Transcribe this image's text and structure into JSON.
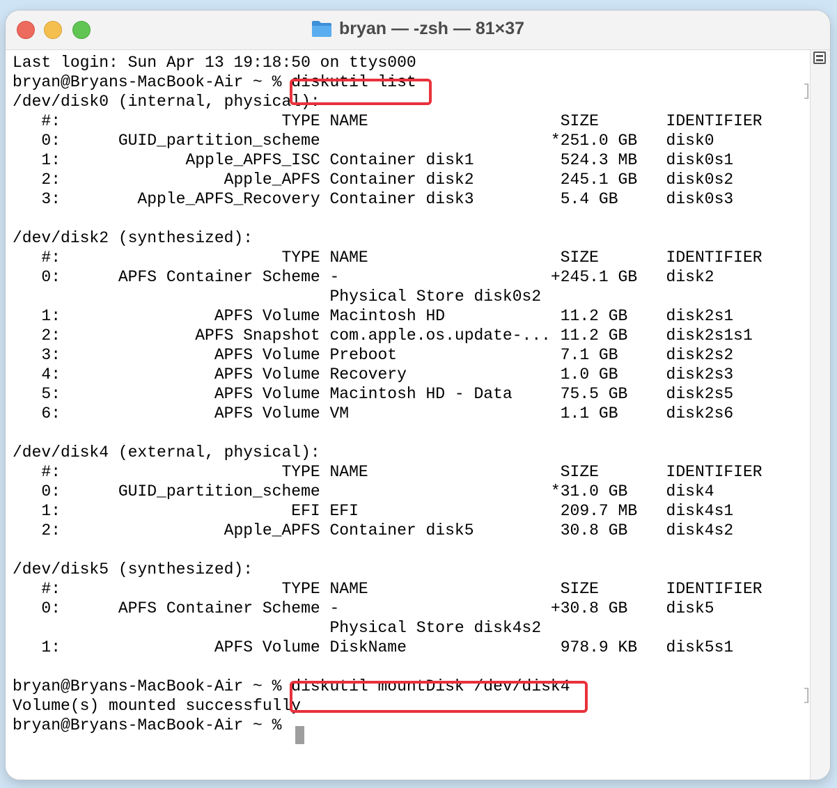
{
  "window": {
    "title": "bryan — -zsh — 81×37"
  },
  "terminal": {
    "lines": [
      "Last login: Sun Apr 13 19:18:50 on ttys000",
      "bryan@Bryans-MacBook-Air ~ % diskutil list",
      "/dev/disk0 (internal, physical):",
      "   #:                       TYPE NAME                    SIZE       IDENTIFIER",
      "   0:      GUID_partition_scheme                        *251.0 GB   disk0",
      "   1:             Apple_APFS_ISC Container disk1         524.3 MB   disk0s1",
      "   2:                 Apple_APFS Container disk2         245.1 GB   disk0s2",
      "   3:        Apple_APFS_Recovery Container disk3         5.4 GB     disk0s3",
      "",
      "/dev/disk2 (synthesized):",
      "   #:                       TYPE NAME                    SIZE       IDENTIFIER",
      "   0:      APFS Container Scheme -                      +245.1 GB   disk2",
      "                                 Physical Store disk0s2",
      "   1:                APFS Volume Macintosh HD            11.2 GB    disk2s1",
      "   2:              APFS Snapshot com.apple.os.update-... 11.2 GB    disk2s1s1",
      "   3:                APFS Volume Preboot                 7.1 GB     disk2s2",
      "   4:                APFS Volume Recovery                1.0 GB     disk2s3",
      "   5:                APFS Volume Macintosh HD - Data     75.5 GB    disk2s5",
      "   6:                APFS Volume VM                      1.1 GB     disk2s6",
      "",
      "/dev/disk4 (external, physical):",
      "   #:                       TYPE NAME                    SIZE       IDENTIFIER",
      "   0:      GUID_partition_scheme                        *31.0 GB    disk4",
      "   1:                        EFI EFI                     209.7 MB   disk4s1",
      "   2:                 Apple_APFS Container disk5         30.8 GB    disk4s2",
      "",
      "/dev/disk5 (synthesized):",
      "   #:                       TYPE NAME                    SIZE       IDENTIFIER",
      "   0:      APFS Container Scheme -                      +30.8 GB    disk5",
      "                                 Physical Store disk4s2",
      "   1:                APFS Volume DiskName                978.9 KB   disk5s1",
      "",
      "bryan@Bryans-MacBook-Air ~ % diskutil mountDisk /dev/disk4",
      "Volume(s) mounted successfully",
      "bryan@Bryans-MacBook-Air ~ % "
    ]
  },
  "colors": {
    "highlight": "#e8323c",
    "terminal_text": "#000000",
    "terminal_bg": "#ffffff"
  }
}
